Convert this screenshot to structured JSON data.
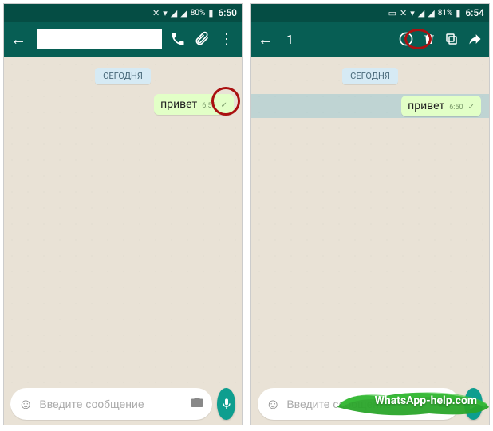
{
  "left": {
    "status": {
      "battery": "80%",
      "time": "6:50"
    },
    "chat": {
      "date_label": "СЕГОДНЯ",
      "message": {
        "text": "привет",
        "time": "6:50"
      },
      "input_placeholder": "Введите сообщение"
    }
  },
  "right": {
    "status": {
      "battery": "81%",
      "time": "6:54"
    },
    "header": {
      "selected_count": "1"
    },
    "chat": {
      "date_label": "СЕГОДНЯ",
      "message": {
        "text": "привет",
        "time": "6:50"
      },
      "input_placeholder": "Введите сообщение"
    }
  },
  "watermark": "WhatsApp-help.com"
}
